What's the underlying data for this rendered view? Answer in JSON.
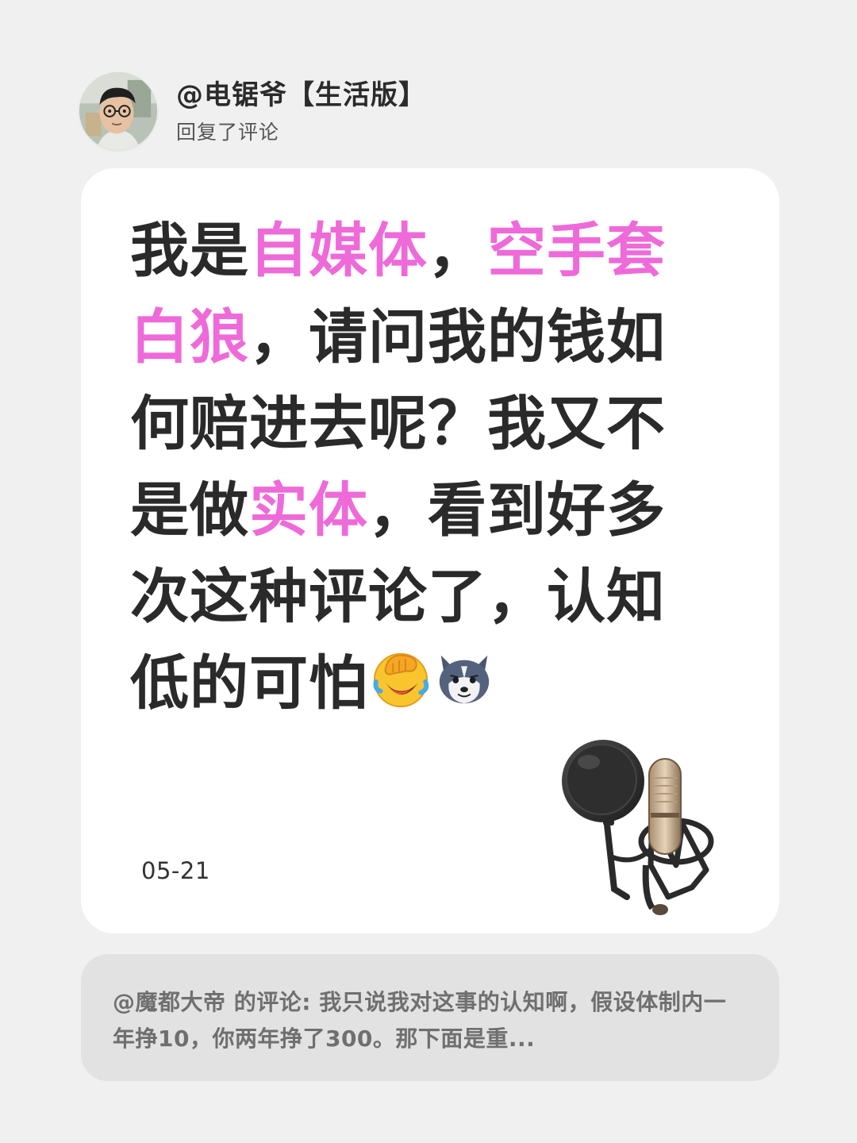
{
  "header": {
    "user_name": "@电锯爷【生活版】",
    "action": "回复了评论"
  },
  "reply": {
    "segments": [
      {
        "text": "我是",
        "highlight": false
      },
      {
        "text": "自媒体",
        "highlight": true
      },
      {
        "text": "，",
        "highlight": false
      },
      {
        "text": "空手套白狼",
        "highlight": true
      },
      {
        "text": "，请问我的钱如何赔进去呢？我又不是做",
        "highlight": false
      },
      {
        "text": "实体",
        "highlight": true
      },
      {
        "text": "，看到好多次这种评论了，认知低的可怕",
        "highlight": false
      }
    ],
    "emojis": [
      "facepalm-laughing-emoji",
      "husky-dog-emoji"
    ],
    "date": "05-21"
  },
  "quoted_comment": {
    "author": "@魔都大帝",
    "label": "的评论: ",
    "text": "我只说我对这事的认知啊，假设体制内一年挣10，你两年挣了300。那下面是重..."
  },
  "colors": {
    "background": "#f0f0f0",
    "card": "#ffffff",
    "highlight": "#ee6ad9",
    "text": "#2a2a2a",
    "quote_bg": "#e2e2e2",
    "quote_text": "#6f6f6f"
  },
  "icons": {
    "decoration": "studio-microphone-icon"
  }
}
